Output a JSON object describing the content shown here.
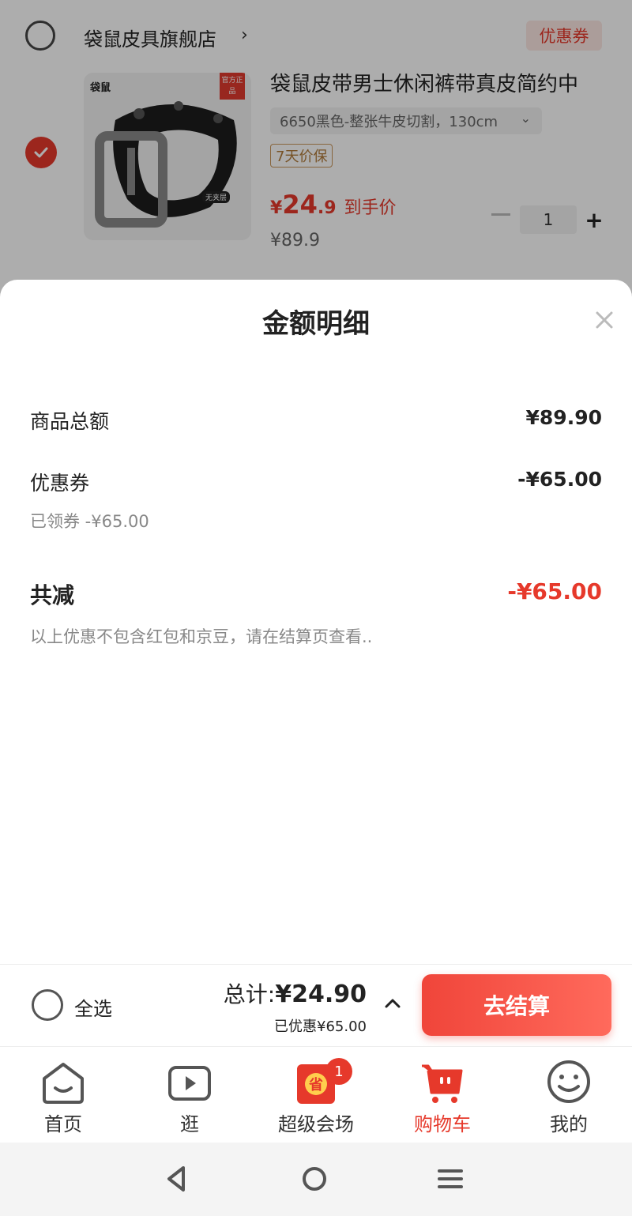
{
  "cart": {
    "store_name": "袋鼠皮具旗舰店",
    "store_chevron": "›",
    "coupon_tag": "优惠券",
    "item": {
      "image_brand": "袋鼠",
      "image_badge_official": "官方正品",
      "image_badge_noclip": "无夹层",
      "title": "袋鼠皮带男士休闲裤带真皮简约中",
      "sku": "6650黑色-整张牛皮切割，130cm",
      "guarantee_tag": "7天价保",
      "price_symbol": "¥",
      "price_int": "24",
      "price_dec": ".9",
      "price_label": "到手价",
      "original_price": "¥89.9",
      "quantity": "1",
      "plus": "+"
    }
  },
  "sheet": {
    "title": "金额明细",
    "rows": [
      {
        "label": "商品总额",
        "value": "¥89.90"
      },
      {
        "label": "优惠券",
        "value": "-¥65.00",
        "sub": "已领券 -¥65.00"
      }
    ],
    "total_label": "共减",
    "total_value": "-¥65.00",
    "note": "以上优惠不包含红包和京豆，请在结算页查看.."
  },
  "checkout": {
    "select_all": "全选",
    "sum_label": "总计:",
    "sum_value": "¥24.90",
    "saved": "已优惠¥65.00",
    "button": "去结算"
  },
  "tabs": [
    {
      "label": "首页",
      "icon": "home-icon"
    },
    {
      "label": "逛",
      "icon": "play-icon"
    },
    {
      "label": "超级会场",
      "icon": "super-venue-icon",
      "badge": "1",
      "icon_text": "省"
    },
    {
      "label": "购物车",
      "icon": "cart-icon",
      "active": true
    },
    {
      "label": "我的",
      "icon": "smile-icon"
    }
  ],
  "colors": {
    "accent": "#e6392b",
    "guarantee": "#b07a38"
  }
}
